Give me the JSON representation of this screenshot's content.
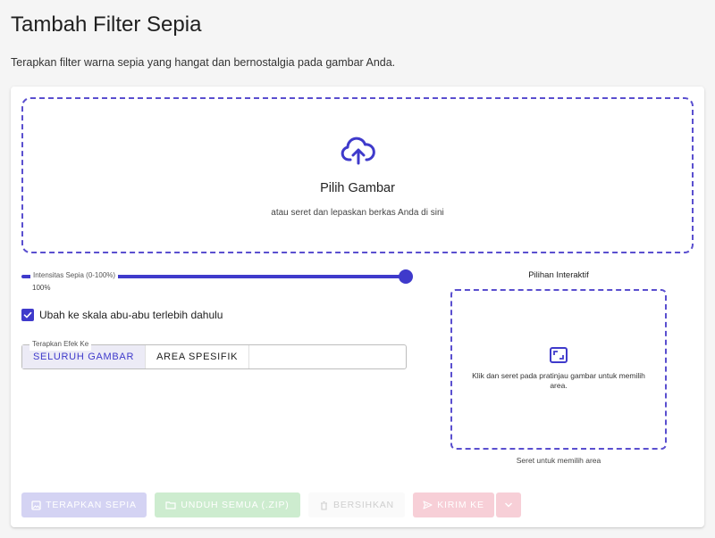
{
  "header": {
    "title": "Tambah Filter Sepia",
    "description": "Terapkan filter warna sepia yang hangat dan bernostalgia pada gambar Anda."
  },
  "upload": {
    "icon": "cloud-upload-icon",
    "title": "Pilih Gambar",
    "subtitle": "atau seret dan lepaskan berkas Anda di sini"
  },
  "intensity": {
    "label": "Intensitas Sepia (0-100%)",
    "value_text": "100%",
    "value": 100
  },
  "grayscale": {
    "label": "Ubah ke skala abu-abu terlebih dahulu",
    "checked": true
  },
  "apply_to": {
    "legend": "Terapkan Efek Ke",
    "options": [
      "SELURUH GAMBAR",
      "AREA SPESIFIK"
    ],
    "selected": "SELURUH GAMBAR"
  },
  "interactive": {
    "title": "Pilihan Interaktif",
    "icon": "select-area-icon",
    "hint": "Klik dan seret pada pratinjau gambar untuk memilih area.",
    "caption": "Seret untuk memilih area"
  },
  "actions": {
    "apply": "TERAPKAN SEPIA",
    "download": "UNDUH SEMUA (.ZIP)",
    "clear": "BERSIHKAN",
    "send": "KIRIM KE"
  },
  "colors": {
    "accent": "#3f3acb",
    "dashed_border": "#5a4fcf",
    "apply_disabled": "#d4d3f3",
    "download_disabled": "#cdeccf",
    "send_disabled": "#f7cfd7"
  }
}
